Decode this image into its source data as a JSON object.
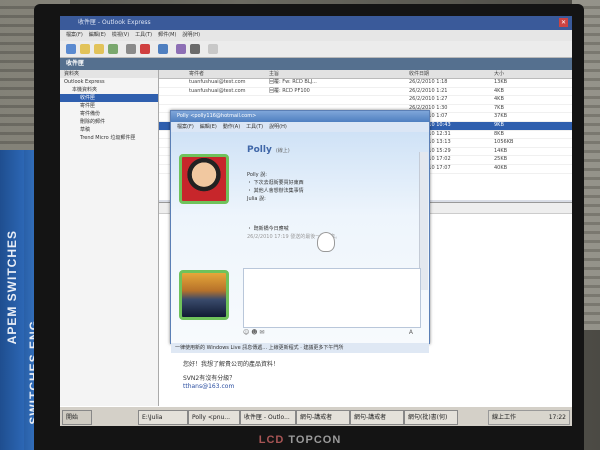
{
  "outlook": {
    "title": "收件匣 - Outlook Express",
    "menu": [
      "檔案(F)",
      "編輯(E)",
      "檢視(V)",
      "工具(T)",
      "郵件(M)",
      "說明(H)"
    ],
    "folder_bar": "收件匣",
    "folders": [
      "Outlook Express",
      "本機資料夾",
      "收件匣",
      "寄件匣",
      "寄件備份",
      "刪除的郵件",
      "草稿",
      "Trend Micro 垃圾郵件匣"
    ],
    "columns": [
      "寄件者",
      "主旨",
      "收件日期",
      "大小"
    ],
    "messages": [
      {
        "from": "tuanfushuai@test.com",
        "subject": "回覆: Fw: RCD BLJ...",
        "date": "26/2/2010 1:18",
        "size": "13KB"
      },
      {
        "from": "tuanfushuai@test.com",
        "subject": "回覆: RCD PF100",
        "date": "26/2/2010 1:21",
        "size": "4KB"
      },
      {
        "from": "",
        "subject": "",
        "date": "26/2/2010 1:27",
        "size": "4KB"
      },
      {
        "from": "",
        "subject": "",
        "date": "26/2/2010 1:30",
        "size": "7KB"
      },
      {
        "from": "",
        "subject": "",
        "date": "26/2/2010 1:07",
        "size": "37KB"
      },
      {
        "from": "",
        "subject": "",
        "date": "26/2/2010 10:43",
        "size": "9KB"
      },
      {
        "from": "",
        "subject": "",
        "date": "26/2/2010 12:31",
        "size": "8KB"
      },
      {
        "from": "",
        "subject": "",
        "date": "26/2/2010 13:13",
        "size": "1056KB"
      },
      {
        "from": "",
        "subject": "",
        "date": "26/2/2010 15:29",
        "size": "14KB"
      },
      {
        "from": "",
        "subject": "",
        "date": "26/2/2010 17:02",
        "size": "25KB"
      },
      {
        "from": "",
        "subject": "",
        "date": "26/2/2010 17:07",
        "size": "40KB"
      }
    ],
    "preview": {
      "lines": [
        "您好！我想了解貴公司的產品資料！",
        "SVN2有沒有分級？",
        "tthans@163.com"
      ]
    }
  },
  "msn": {
    "title": "Polly <polly116@hotmail.com>",
    "menu": [
      "檔案(F)",
      "編輯(E)",
      "動作(A)",
      "工具(T)",
      "說明(H)"
    ],
    "contact": "Polly",
    "contact_status": "(線上)",
    "chat_lines": [
      "Polly 說:",
      "・ 下次去逛街要買好東西",
      "・ 其他人會想辦法集事情",
      "Julia 說:",
      "・ 既新橋今日應喊",
      "26/2/2010 17:19 發送的最後一則訊息。"
    ],
    "status_bar": "一律使用新的 Windows Live 訊息傳遞... 上線更新程式 · 建議更多下午門所"
  },
  "taskbar": {
    "start": "開始",
    "buttons": [
      "E:\\Julia",
      "Polly <pnu...",
      "收件匣 - Outlo...",
      "網句-講戒者",
      "網句-講戒者",
      "網句(批)書(何)"
    ],
    "tray_status": "線上工作",
    "clock": "17:22"
  },
  "monitor": {
    "brand_lcd": "LCD",
    "brand_name": "TOPCON"
  },
  "books": [
    "APEM SWITCHES",
    "SWITCHES ENG"
  ]
}
